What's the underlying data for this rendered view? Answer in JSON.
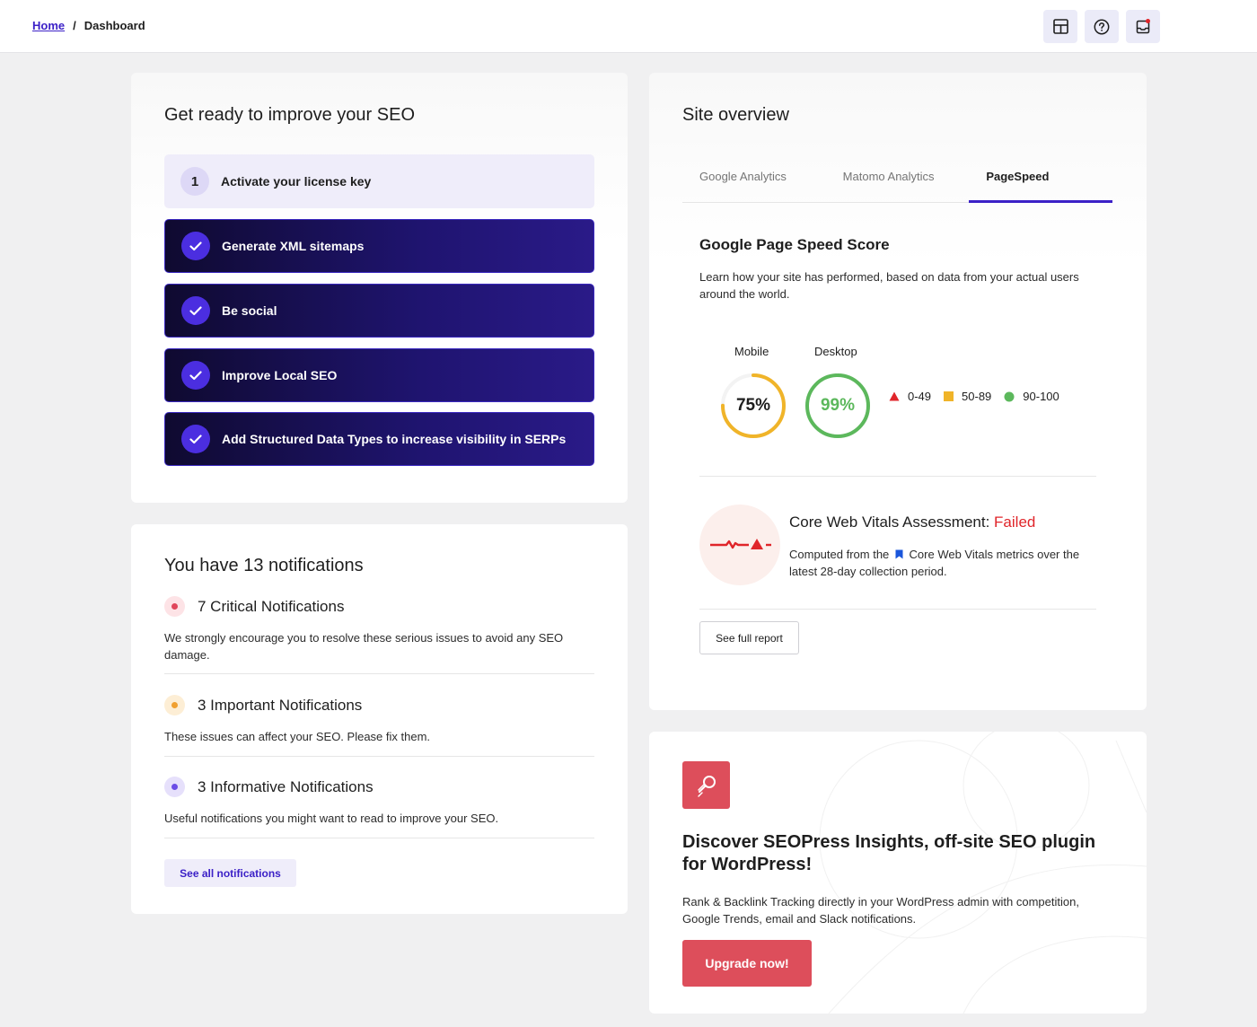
{
  "breadcrumb": {
    "home": "Home",
    "separator": "/",
    "current": "Dashboard"
  },
  "topbar_icons": [
    "layout-grid-icon",
    "help-circle-icon",
    "notifications-inbox-icon"
  ],
  "improve": {
    "title": "Get ready to improve your SEO",
    "tasks": [
      {
        "number": "1",
        "label": "Activate your license key",
        "done": false
      },
      {
        "label": "Generate XML sitemaps",
        "done": true
      },
      {
        "label": "Be social",
        "done": true
      },
      {
        "label": "Improve Local SEO",
        "done": true
      },
      {
        "label": "Add Structured Data Types to increase visibility in SERPs",
        "done": true
      }
    ]
  },
  "notifications": {
    "title": "You have 13 notifications",
    "groups": [
      {
        "label": "7 Critical Notifications",
        "description": "We strongly encourage you to resolve these serious issues to avoid any SEO damage.",
        "color": "#e0465b"
      },
      {
        "label": "3 Important Notifications",
        "description": "These issues can affect your SEO. Please fix them.",
        "color": "#f0a030"
      },
      {
        "label": "3 Informative Notifications",
        "description": "Useful notifications you might want to read to improve your SEO.",
        "color": "#6b4de6"
      }
    ],
    "see_all": "See all notifications"
  },
  "site_overview": {
    "title": "Site overview",
    "tabs": [
      "Google Analytics",
      "Matomo Analytics",
      "PageSpeed"
    ],
    "active_tab": "PageSpeed",
    "pagespeed": {
      "title": "Google Page Speed Score",
      "description": "Learn how your site has performed, based on data from your actual users around the world.",
      "mobile": {
        "label": "Mobile",
        "score": "75%",
        "value": 0.75,
        "color": "#f0b429"
      },
      "desktop": {
        "label": "Desktop",
        "score": "99%",
        "value": 0.99,
        "color": "#5cb85c"
      },
      "legend": [
        {
          "range": "0-49",
          "color": "#e0252a",
          "shape": "triangle"
        },
        {
          "range": "50-89",
          "color": "#f0b429",
          "shape": "square"
        },
        {
          "range": "90-100",
          "color": "#5cb85c",
          "shape": "circle"
        }
      ]
    },
    "cwv": {
      "title": "Core Web Vitals Assessment:",
      "status": "Failed",
      "desc_before": "Computed from the",
      "desc_after": "Core Web Vitals metrics over the latest 28-day collection period."
    },
    "see_full_report": "See full report"
  },
  "insights": {
    "title": "Discover SEOPress Insights, off-site SEO plugin for WordPress!",
    "description": "Rank & Backlink Tracking directly in your WordPress admin with competition, Google Trends, email and Slack notifications.",
    "button": "Upgrade now!"
  }
}
